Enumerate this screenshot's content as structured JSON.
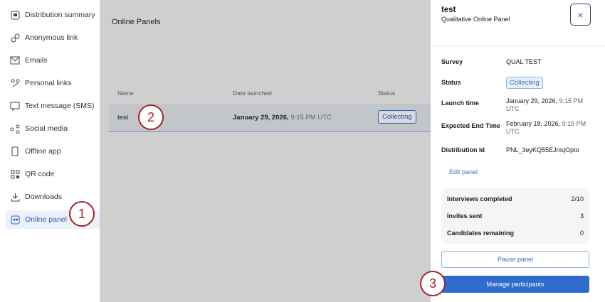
{
  "sidebar": {
    "items": [
      {
        "label": "Distribution summary",
        "icon": "summary-icon"
      },
      {
        "label": "Anonymous link",
        "icon": "link-icon"
      },
      {
        "label": "Emails",
        "icon": "envelope-icon"
      },
      {
        "label": "Personal links",
        "icon": "personal-link-icon"
      },
      {
        "label": "Text message (SMS)",
        "icon": "message-icon"
      },
      {
        "label": "Social media",
        "icon": "share-icon"
      },
      {
        "label": "Offline app",
        "icon": "phone-icon"
      },
      {
        "label": "QR code",
        "icon": "qr-icon"
      },
      {
        "label": "Downloads",
        "icon": "download-icon"
      },
      {
        "label": "Online panel",
        "icon": "panel-icon",
        "active": true
      }
    ]
  },
  "main": {
    "title": "Online Panels",
    "columns": [
      "Name",
      "Date launched",
      "Status"
    ],
    "rows": [
      {
        "name": "test",
        "date": "January 29, 2026,",
        "time": "9:15 PM UTC",
        "status": "Collecting"
      }
    ]
  },
  "panel": {
    "title": "test",
    "subtitle": "Qualitative Online Panel",
    "close": "×",
    "survey_label": "Survey",
    "survey": "QUAL TEST",
    "status_label": "Status",
    "status": "Collecting",
    "launch_label": "Launch time",
    "launch_date": "January 29, 2026,",
    "launch_time": "9:15 PM",
    "launch_tz": "UTC",
    "end_label": "Expected End Time",
    "end_date": "February 18, 2026,",
    "end_time": "9:15 PM",
    "end_tz": "UTC",
    "id_label": "Distribution Id",
    "id": "PNL_3eyKQ55EJmqOpto",
    "edit": "Edit panel",
    "stats": [
      {
        "label": "Interviews completed",
        "value": "2/10"
      },
      {
        "label": "Invites sent",
        "value": "3"
      },
      {
        "label": "Candidates remaining",
        "value": "0"
      }
    ],
    "pause": "Pause panel",
    "manage": "Manage participants"
  },
  "callouts": [
    "1",
    "2",
    "3"
  ],
  "colors": {
    "accent": "#2f6ccf",
    "callout": "#a3222d",
    "overlay": "#cfcfcf"
  }
}
